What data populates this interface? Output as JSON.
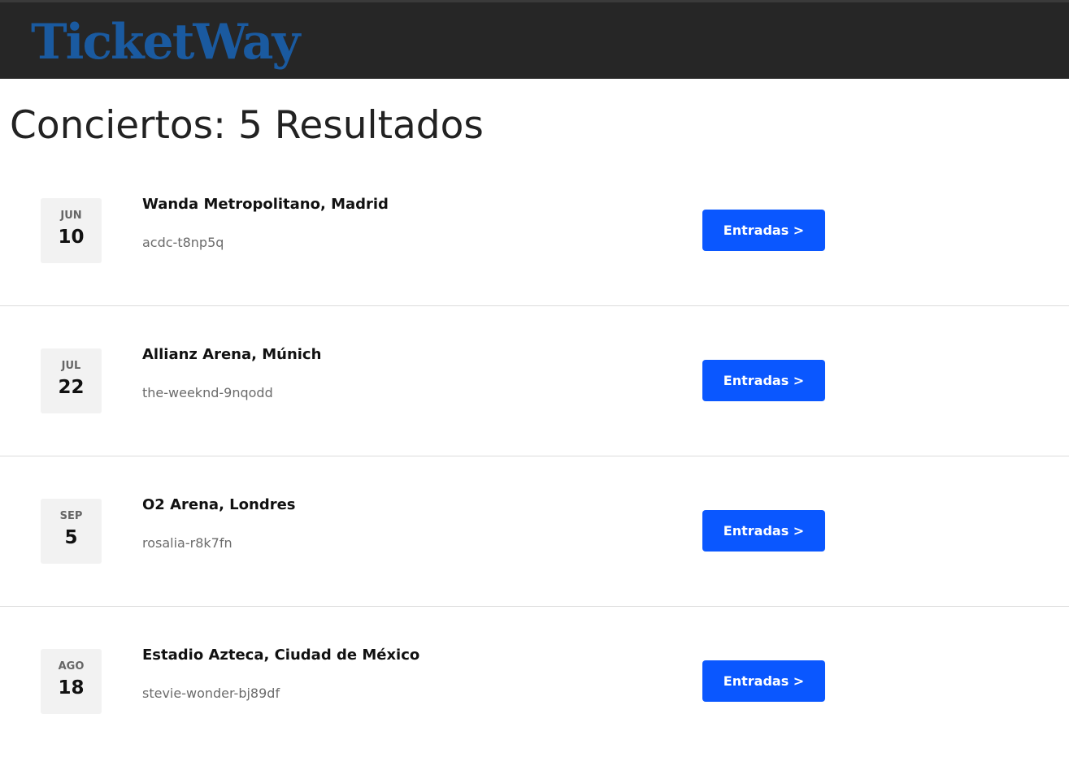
{
  "header": {
    "logo": "TicketWay",
    "logo_color": "#1a5aa0",
    "background": "#262626"
  },
  "page": {
    "title": "Conciertos: 5 Resultados"
  },
  "accent_color": "#0a57ff",
  "events": [
    {
      "month": "JUN",
      "day": "10",
      "venue": "Wanda Metropolitano, Madrid",
      "slug": "acdc-t8np5q",
      "button_label": "Entradas >"
    },
    {
      "month": "JUL",
      "day": "22",
      "venue": "Allianz Arena, Múnich",
      "slug": "the-weeknd-9nqodd",
      "button_label": "Entradas >"
    },
    {
      "month": "SEP",
      "day": "5",
      "venue": "O2 Arena, Londres",
      "slug": "rosalia-r8k7fn",
      "button_label": "Entradas >"
    },
    {
      "month": "AGO",
      "day": "18",
      "venue": "Estadio Azteca, Ciudad de México",
      "slug": "stevie-wonder-bj89df",
      "button_label": "Entradas >"
    }
  ]
}
